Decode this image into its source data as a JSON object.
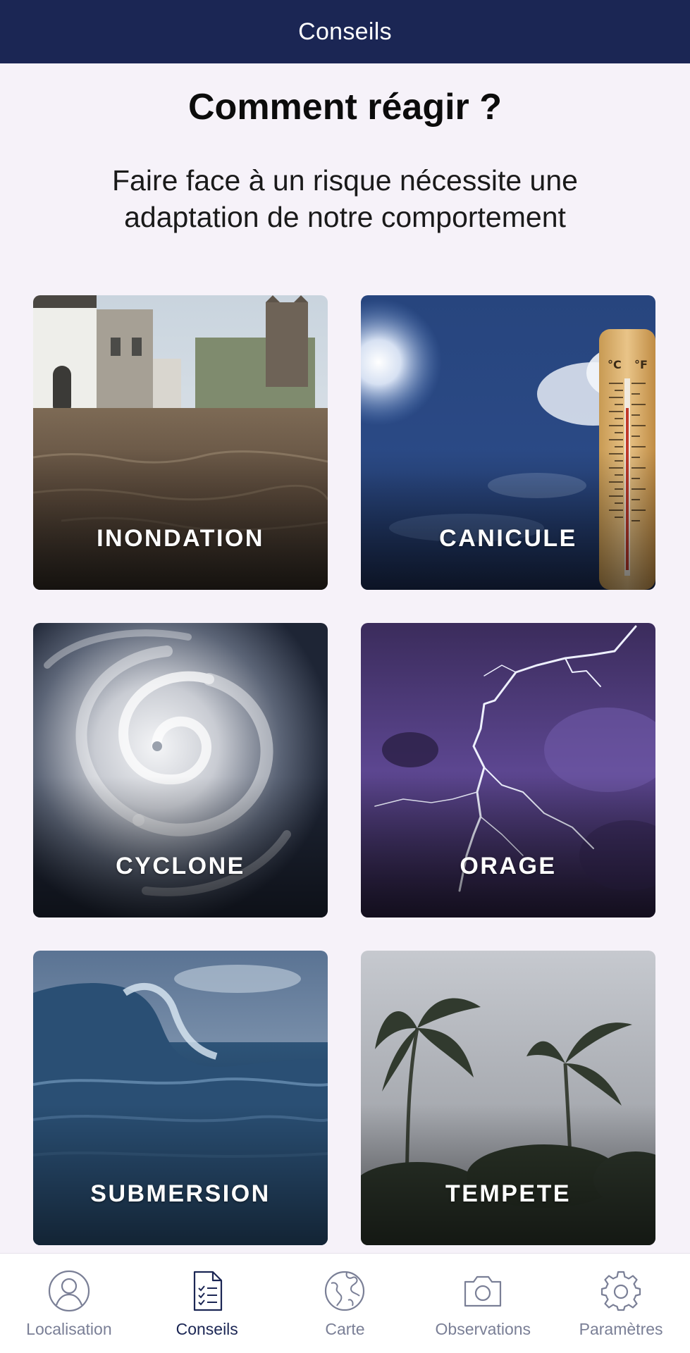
{
  "header": {
    "title": "Conseils"
  },
  "main": {
    "heading": "Comment réagir ?",
    "subtitle": "Faire face à un risque nécessite une adaptation de notre comportement"
  },
  "cards": [
    {
      "label": "INONDATION",
      "image": "flooded-village-street"
    },
    {
      "label": "CANICULE",
      "image": "sun-sky-thermometer"
    },
    {
      "label": "CYCLONE",
      "image": "satellite-cyclone"
    },
    {
      "label": "ORAGE",
      "image": "lightning-purple-sky"
    },
    {
      "label": "SUBMERSION",
      "image": "breaking-wave"
    },
    {
      "label": "TEMPETE",
      "image": "palm-trees-storm"
    }
  ],
  "thermometer": {
    "celsius_mark": "°C",
    "fahrenheit_mark": "°F"
  },
  "tabbar": {
    "items": [
      {
        "label": "Localisation",
        "icon": "user-circle-icon",
        "active": false
      },
      {
        "label": "Conseils",
        "icon": "checklist-document-icon",
        "active": true
      },
      {
        "label": "Carte",
        "icon": "globe-icon",
        "active": false
      },
      {
        "label": "Observations",
        "icon": "camera-icon",
        "active": false
      },
      {
        "label": "Paramètres",
        "icon": "gear-icon",
        "active": false
      }
    ]
  },
  "colors": {
    "header_bg": "#1b2654",
    "page_bg": "#f6f2f9",
    "tab_inactive": "#7a7f96",
    "tab_active": "#1b2654"
  }
}
